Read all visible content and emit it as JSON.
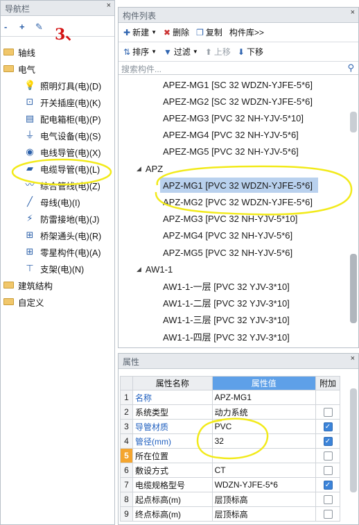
{
  "nav": {
    "title": "导航栏",
    "pin": "×",
    "toolbar": {
      "collapse": "-",
      "expand": "+",
      "edit": "✎"
    },
    "annotation": "3、",
    "tree": [
      {
        "label": "轴线",
        "level": 0,
        "expanded": false
      },
      {
        "label": "电气",
        "level": 0,
        "expanded": true
      },
      {
        "label": "照明灯具(电)(D)",
        "level": 1,
        "icon": "lightbulb-icon"
      },
      {
        "label": "开关插座(电)(K)",
        "level": 1,
        "icon": "switch-socket-icon"
      },
      {
        "label": "配电箱柜(电)(P)",
        "level": 1,
        "icon": "distribution-box-icon"
      },
      {
        "label": "电气设备(电)(S)",
        "level": 1,
        "icon": "electrical-device-icon"
      },
      {
        "label": "电线导管(电)(X)",
        "level": 1,
        "icon": "wire-conduit-icon"
      },
      {
        "label": "电缆导管(电)(L)",
        "level": 1,
        "icon": "cable-conduit-icon",
        "selected": true
      },
      {
        "label": "综合管线(电)(Z)",
        "level": 1,
        "icon": "pipeline-icon"
      },
      {
        "label": "母线(电)(I)",
        "level": 1,
        "icon": "busbar-icon"
      },
      {
        "label": "防雷接地(电)(J)",
        "level": 1,
        "icon": "lightning-ground-icon"
      },
      {
        "label": "桥架通头(电)(R)",
        "level": 1,
        "icon": "tray-fitting-icon"
      },
      {
        "label": "零星构件(电)(A)",
        "level": 1,
        "icon": "grid-components-icon"
      },
      {
        "label": "支架(电)(N)",
        "level": 1,
        "icon": "bracket-icon"
      },
      {
        "label": "建筑结构",
        "level": 0,
        "expanded": false
      },
      {
        "label": "自定义",
        "level": 0,
        "expanded": false
      }
    ]
  },
  "list": {
    "title": "构件列表",
    "toolbar": {
      "new": "新建",
      "delete": "删除",
      "copy": "复制",
      "library": "构件库>>",
      "sort": "排序",
      "filter": "过滤",
      "up": "上移",
      "down": "下移"
    },
    "search_placeholder": "搜索构件...",
    "items": [
      {
        "text": "APEZ-MG1 [SC 32 WDZN-YJFE-5*6]",
        "type": "item"
      },
      {
        "text": "APEZ-MG2 [SC 32 WDZN-YJFE-5*6]",
        "type": "item"
      },
      {
        "text": "APEZ-MG3 [PVC 32 NH-YJV-5*10]",
        "type": "item"
      },
      {
        "text": "APEZ-MG4 [PVC 32 NH-YJV-5*6]",
        "type": "item"
      },
      {
        "text": "APEZ-MG5 [PVC 32 NH-YJV-5*6]",
        "type": "item"
      },
      {
        "text": "APZ",
        "type": "group"
      },
      {
        "text": "APZ-MG1 [PVC 32 WDZN-YJFE-5*6]",
        "type": "item",
        "selected": true
      },
      {
        "text": "APZ-MG2 [PVC 32 WDZN-YJFE-5*6]",
        "type": "item"
      },
      {
        "text": "APZ-MG3 [PVC 32 NH-YJV-5*10]",
        "type": "item"
      },
      {
        "text": "APZ-MG4 [PVC 32 NH-YJV-5*6]",
        "type": "item"
      },
      {
        "text": "APZ-MG5 [PVC 32 NH-YJV-5*6]",
        "type": "item"
      },
      {
        "text": "AW1-1",
        "type": "group"
      },
      {
        "text": "AW1-1-一层 [PVC 32 YJV-3*10]",
        "type": "item"
      },
      {
        "text": "AW1-1-二层 [PVC 32 YJV-3*10]",
        "type": "item"
      },
      {
        "text": "AW1-1-三层 [PVC 32 YJV-3*10]",
        "type": "item"
      },
      {
        "text": "AW1-1-四层 [PVC 32 YJV-3*10]",
        "type": "item"
      }
    ]
  },
  "props": {
    "title": "属性",
    "headers": {
      "name": "属性名称",
      "value": "属性值",
      "extra": "附加"
    },
    "rows": [
      {
        "n": "1",
        "name": "名称",
        "value": "APZ-MG1",
        "blue": true,
        "checkbox": false,
        "has_check": false
      },
      {
        "n": "2",
        "name": "系统类型",
        "value": "动力系统",
        "blue": false,
        "checkbox": false,
        "has_check": true
      },
      {
        "n": "3",
        "name": "导管材质",
        "value": "PVC",
        "blue": true,
        "checkbox": true,
        "has_check": true
      },
      {
        "n": "4",
        "name": "管径(mm)",
        "value": "32",
        "blue": true,
        "checkbox": true,
        "has_check": true
      },
      {
        "n": "5",
        "name": "所在位置",
        "value": "",
        "blue": false,
        "checkbox": false,
        "has_check": true,
        "current": true
      },
      {
        "n": "6",
        "name": "敷设方式",
        "value": "CT",
        "blue": false,
        "checkbox": false,
        "has_check": true
      },
      {
        "n": "7",
        "name": "电缆规格型号",
        "value": "WDZN-YJFE-5*6",
        "blue": false,
        "checkbox": true,
        "has_check": true
      },
      {
        "n": "8",
        "name": "起点标高(m)",
        "value": "层顶标高",
        "blue": false,
        "checkbox": false,
        "has_check": true
      },
      {
        "n": "9",
        "name": "终点标高(m)",
        "value": "层顶标高",
        "blue": false,
        "checkbox": false,
        "has_check": true
      }
    ]
  }
}
